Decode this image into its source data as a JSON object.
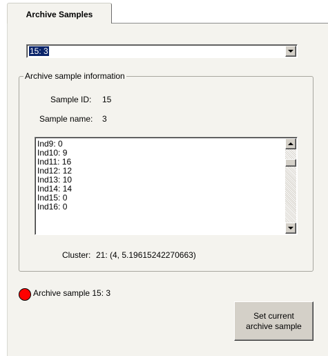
{
  "tab": {
    "label": "Archive Samples"
  },
  "archive_select": {
    "selected_value": "15: 3"
  },
  "group": {
    "title": "Archive sample information",
    "sample_id_label": "Sample ID:",
    "sample_id_value": "15",
    "sample_name_label": "Sample name:",
    "sample_name_value": "3",
    "list_items": [
      "Ind9: 0",
      "Ind10: 9",
      "Ind11: 16",
      "Ind12: 12",
      "Ind13: 10",
      "Ind14: 14",
      "Ind15: 0",
      "Ind16: 0"
    ],
    "cluster_label": "Cluster:",
    "cluster_value": "21: (4, 5.19615242270663)"
  },
  "status": {
    "text": "Archive sample 15: 3",
    "color": "#ff0000"
  },
  "set_button": {
    "line1": "Set current",
    "line2": "archive sample"
  },
  "icons": {
    "dropdown": "chevron-down-icon",
    "scroll_up": "scroll-up-arrow-icon",
    "scroll_down": "scroll-down-arrow-icon"
  }
}
